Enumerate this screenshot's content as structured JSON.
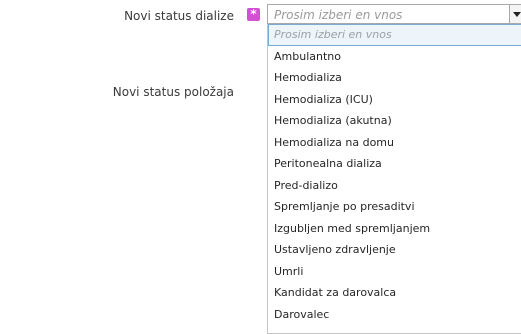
{
  "form": {
    "status_label": "Novi status dialize",
    "position_label": "Novi status položaja",
    "required_marker": "*"
  },
  "colors": {
    "required": "#d34fd3"
  },
  "select": {
    "placeholder": "Prosim izberi en vnos",
    "icon": "chevron-down-icon"
  },
  "dropdown": {
    "options": [
      "Prosim izberi en vnos",
      "Ambulantno",
      "Hemodializa",
      "Hemodializa (ICU)",
      "Hemodializa (akutna)",
      "Hemodializa na domu",
      "Peritonealna dializa",
      "Pred-dializo",
      "Spremljanje po presaditvi",
      "Izgubljen med spremljanjem",
      "Ustavljeno zdravljenje",
      "Umrli",
      "Kandidat za darovalca",
      "Darovalec"
    ]
  }
}
